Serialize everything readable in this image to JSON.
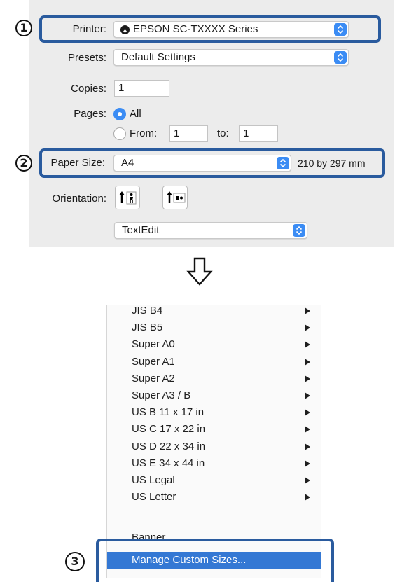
{
  "dialog": {
    "printer_label": "Printer:",
    "printer_value": "EPSON SC-TXXXX Series",
    "presets_label": "Presets:",
    "presets_value": "Default Settings",
    "copies_label": "Copies:",
    "copies_value": "1",
    "pages_label": "Pages:",
    "pages_all": "All",
    "pages_from": "From:",
    "from_value": "1",
    "pages_to": "to:",
    "to_value": "1",
    "paper_size_label": "Paper Size:",
    "paper_size_value": "A4",
    "paper_size_dims": "210 by 297 mm",
    "orientation_label": "Orientation:",
    "app_section": "TextEdit"
  },
  "steps": [
    "1",
    "2",
    "3"
  ],
  "menu": {
    "items": [
      {
        "label": "JIS B4",
        "has_submenu": true
      },
      {
        "label": "JIS B5",
        "has_submenu": true
      },
      {
        "label": "Super A0",
        "has_submenu": true
      },
      {
        "label": "Super A1",
        "has_submenu": true
      },
      {
        "label": "Super A2",
        "has_submenu": true
      },
      {
        "label": "Super A3 / B",
        "has_submenu": true
      },
      {
        "label": "US B 11 x 17 in",
        "has_submenu": true
      },
      {
        "label": "US C 17 x 22 in",
        "has_submenu": true
      },
      {
        "label": "US D 22 x 34 in",
        "has_submenu": true
      },
      {
        "label": "US E 34 x 44 in",
        "has_submenu": true
      },
      {
        "label": "US Legal",
        "has_submenu": true
      },
      {
        "label": "US Letter",
        "has_submenu": true
      }
    ],
    "banner": "Banner",
    "manage": "Manage Custom Sizes..."
  },
  "colors": {
    "highlight_border": "#2a5b9e",
    "accent": "#3b8cf4",
    "menu_selection": "#3478d4"
  },
  "icons": {
    "down_arrow": "down-arrow-icon",
    "printer_status": "printer-status-icon",
    "portrait": "portrait-icon",
    "landscape": "landscape-icon"
  }
}
